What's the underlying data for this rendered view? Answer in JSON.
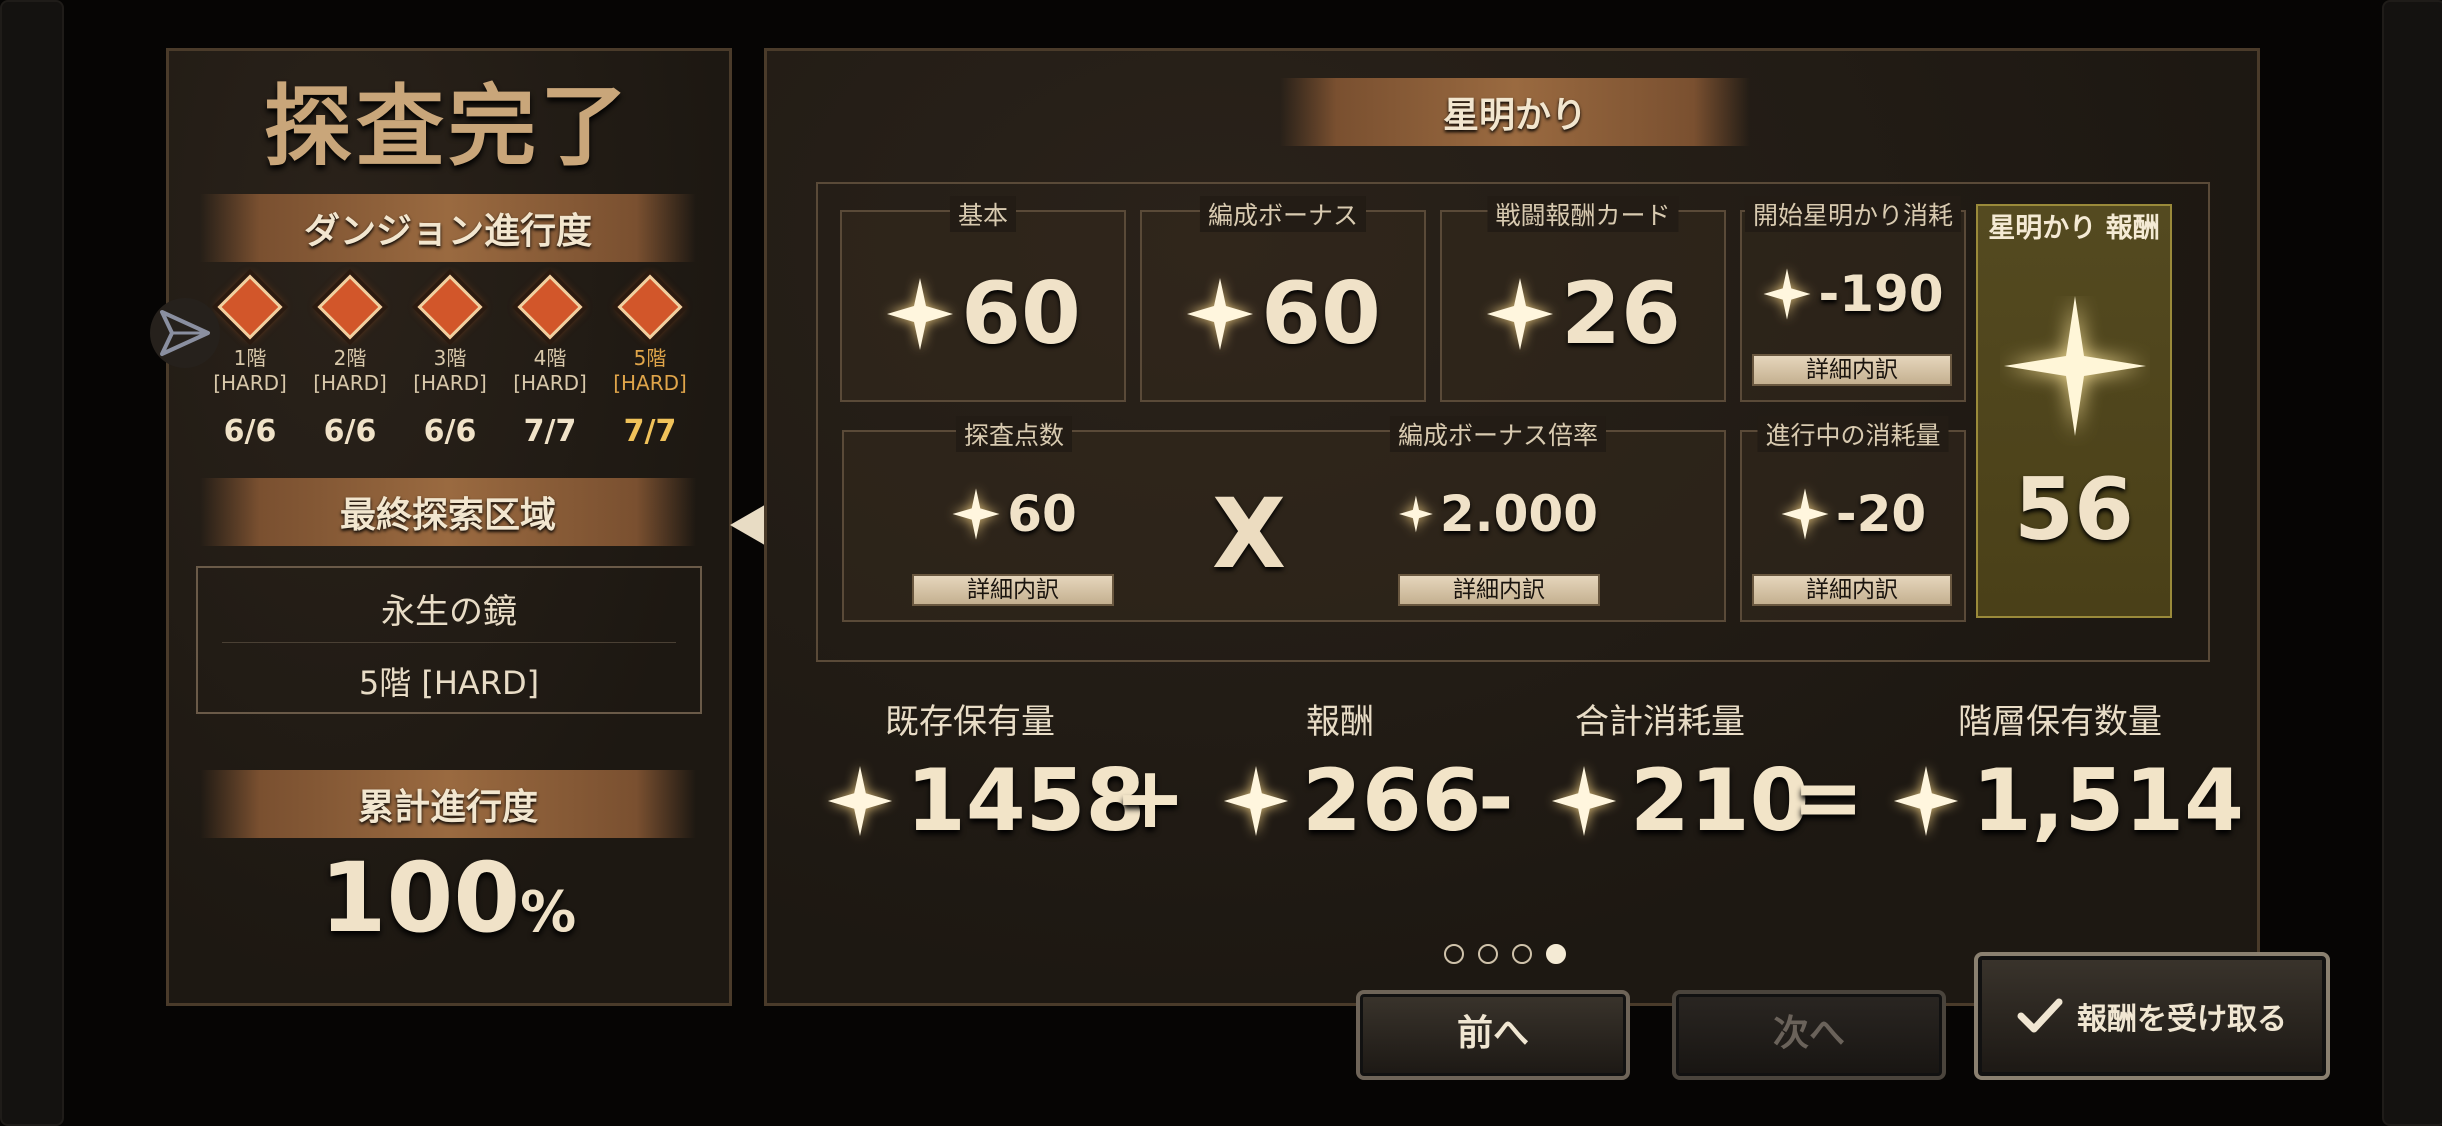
{
  "summary_panel": {
    "title": "探査完了",
    "progress_header": "ダンジョン進行度",
    "floors": [
      {
        "name": "1階",
        "mode": "[HARD]",
        "count": "6/6",
        "current": false
      },
      {
        "name": "2階",
        "mode": "[HARD]",
        "count": "6/6",
        "current": false
      },
      {
        "name": "3階",
        "mode": "[HARD]",
        "count": "6/6",
        "current": false
      },
      {
        "name": "4階",
        "mode": "[HARD]",
        "count": "7/7",
        "current": false
      },
      {
        "name": "5階",
        "mode": "[HARD]",
        "count": "7/7",
        "current": true
      }
    ],
    "final_area_header": "最終探索区域",
    "final_area_name": "永生の鏡",
    "final_area_floor": "5階 [HARD]",
    "cumulative_header": "累計進行度",
    "cumulative_value": "100",
    "cumulative_unit": "%"
  },
  "starlight_panel": {
    "header": "星明かり",
    "base": {
      "label": "基本",
      "value": "60"
    },
    "formation_bonus": {
      "label": "編成ボーナス",
      "value": "60"
    },
    "battle_card": {
      "label": "戦闘報酬カード",
      "value": "26"
    },
    "start_cost": {
      "label": "開始星明かり消耗",
      "value": "-190",
      "button": "詳細内訳"
    },
    "exploration_points": {
      "label": "探査点数",
      "value": "60",
      "button": "詳細内訳"
    },
    "multiply_sign": "X",
    "bonus_multiplier": {
      "label": "編成ボーナス倍率",
      "value": "2.000",
      "button": "詳細内訳"
    },
    "ongoing_cost": {
      "label": "進行中の消耗量",
      "value": "-20",
      "button": "詳細内訳"
    },
    "reward": {
      "label": "星明かり 報酬",
      "value": "56"
    }
  },
  "totals": {
    "existing": {
      "label": "既存保有量",
      "value": "1458"
    },
    "plus": "+",
    "reward": {
      "label": "報酬",
      "value": "266"
    },
    "minus": "-",
    "consumed": {
      "label": "合計消耗量",
      "value": "210"
    },
    "equals": "=",
    "floor_holdings": {
      "label": "階層保有数量",
      "value": "1,514"
    }
  },
  "pagination": {
    "total": 4,
    "current": 4
  },
  "buttons": {
    "prev": "前へ",
    "next": "次へ",
    "claim": "報酬を受け取る"
  },
  "colors": {
    "panel_bg": "#211b14",
    "accent_gold": "#f0c25a",
    "reward_bg": "#544a20",
    "text_cream": "#f0e2c8"
  },
  "icons": [
    "share-icon",
    "gem-icon",
    "star-icon",
    "check-icon",
    "left-arrow-icon"
  ]
}
